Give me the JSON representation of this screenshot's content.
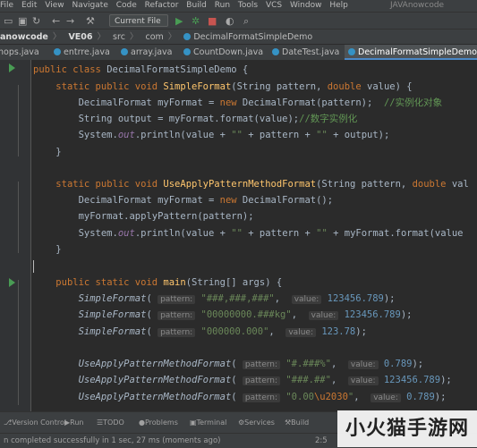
{
  "menu": {
    "items": [
      "File",
      "Edit",
      "View",
      "Navigate",
      "Code",
      "Refactor",
      "Build",
      "Run",
      "Tools",
      "VCS",
      "Window",
      "Help"
    ],
    "project": "JAVAnowcode"
  },
  "toolbar": {
    "run_config": "Current File"
  },
  "breadcrumb": {
    "root": "anowcode",
    "module": "VE06",
    "src": "src",
    "pkg": "com",
    "cls": "DecimalFormatSimpleDemo"
  },
  "tabs": [
    {
      "label": "hops.java"
    },
    {
      "label": "entrre.java"
    },
    {
      "label": "array.java"
    },
    {
      "label": "CountDown.java"
    },
    {
      "label": "DateTest.java"
    },
    {
      "label": "DecimalFormatSimpleDemo.java",
      "active": true
    }
  ],
  "code": {
    "l1": {
      "kw1": "public class ",
      "name": "DecimalFormatSimpleDemo {"
    },
    "l2": {
      "kw1": "static public void ",
      "fn": "SimpleFormat",
      "p1": "(String pattern, ",
      "kw2": "double",
      "p2": " value) {"
    },
    "l3": {
      "a": "DecimalFormat myFormat = ",
      "kw": "new",
      "b": " DecimalFormat(pattern);  ",
      "cm": "//实例化对象"
    },
    "l4": {
      "a": "String output = myFormat.format(value);",
      "cm": "//数字实例化"
    },
    "l5": {
      "a": "System.",
      "field": "out",
      "b": ".println(value + ",
      "s1": "\"\"",
      "c": " + pattern + ",
      "s2": "\"\"",
      "d": " + output);"
    },
    "l6": {
      "a": "}"
    },
    "l7": {
      "kw1": "static public void ",
      "fn": "UseApplyPatternMethodFormat",
      "p1": "(String pattern, ",
      "kw2": "double",
      "p2": " val"
    },
    "l8": {
      "a": "DecimalFormat myFormat = ",
      "kw": "new",
      "b": " DecimalFormat();"
    },
    "l9": {
      "a": "myFormat.applyPattern(pattern);"
    },
    "l10": {
      "a": "System.",
      "field": "out",
      "b": ".println(value + ",
      "s1": "\"\"",
      "c": " + pattern + ",
      "s2": "\"\"",
      "d": " + myFormat.format(value"
    },
    "l11": {
      "a": "}"
    },
    "l12": {
      "kw1": "public static void ",
      "fn": "main",
      "p1": "(String[] args) {"
    },
    "l13": {
      "fn": "SimpleFormat",
      "h1": "pattern:",
      "s": "\"###,###,###\"",
      "h2": "value:",
      "n": "123456.789",
      "end": ");"
    },
    "l14": {
      "fn": "SimpleFormat",
      "h1": "pattern:",
      "s": "\"00000000.###kg\"",
      "h2": "value:",
      "n": "123456.789",
      "end": ");"
    },
    "l15": {
      "fn": "SimpleFormat",
      "h1": "pattern:",
      "s": "\"000000.000\"",
      "h2": "value:",
      "n": "123.78",
      "end": ");"
    },
    "l16": {
      "fn": "UseApplyPatternMethodFormat",
      "h1": "pattern:",
      "s": "\"#.###%\"",
      "h2": "value:",
      "n": "0.789",
      "end": ");"
    },
    "l17": {
      "fn": "UseApplyPatternMethodFormat",
      "h1": "pattern:",
      "s": "\"###.##\"",
      "h2": "value:",
      "n": "123456.789",
      "end": ");"
    },
    "l18": {
      "fn": "UseApplyPatternMethodFormat",
      "h1": "pattern:",
      "s1": "\"0.00",
      "esc": "\\u2030",
      "s2": "\"",
      "h2": "value:",
      "n": "0.789",
      "end": ");"
    }
  },
  "tool_windows": [
    "Version Control",
    "Run",
    "TODO",
    "Problems",
    "Terminal",
    "Services",
    "Build"
  ],
  "status": {
    "message": "n completed successfully in 1 sec, 27 ms (moments ago)",
    "position": "2:5"
  },
  "watermark": "小火猫手游网"
}
